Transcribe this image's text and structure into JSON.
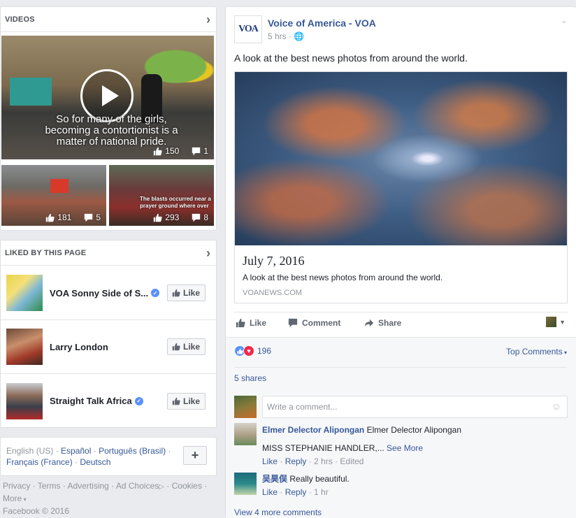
{
  "videos": {
    "title": "VIDEOS",
    "main": {
      "caption": "So for many of the girls, becoming a contortionist is a matter of national pride.",
      "likes": "150",
      "comments": "1"
    },
    "small": [
      {
        "likes": "181",
        "comments": "5"
      },
      {
        "caption": "The blasts occurred near a prayer ground where over",
        "likes": "293",
        "comments": "8"
      }
    ]
  },
  "liked": {
    "title": "LIKED BY THIS PAGE",
    "like_label": "Like",
    "items": [
      {
        "name": "VOA Sonny Side of S...",
        "verified": true
      },
      {
        "name": "Larry London",
        "verified": false
      },
      {
        "name": "Straight Talk Africa",
        "verified": true
      }
    ]
  },
  "languages": {
    "line1": [
      "English (US)",
      "Español",
      "Português (Brasil)"
    ],
    "line2": [
      "Français (France)",
      "Deutsch"
    ],
    "plus": "+"
  },
  "footer": {
    "links": [
      "Privacy",
      "Terms",
      "Advertising",
      "Ad Choices",
      "Cookies"
    ],
    "more": "More",
    "copyright": "Facebook © 2016"
  },
  "post": {
    "page_name": "Voice of America - VOA",
    "time": "5 hrs",
    "logo_text": "VOA",
    "text": "A look at the best news photos from around the world.",
    "link_title": "July 7, 2016",
    "link_desc": "A look at the best news photos from around the world.",
    "link_domain": "VOANEWS.COM",
    "actions": {
      "like": "Like",
      "comment": "Comment",
      "share": "Share"
    },
    "reactions_count": "196",
    "top_comments": "Top Comments",
    "shares": "5 shares",
    "comment_placeholder": "Write a comment...",
    "comments": [
      {
        "name": "Elmer Delector Alipongan",
        "text": "Elmer Delector Alipongan",
        "text2": "MISS STEPHANIE HANDLER,...",
        "see_more": "See More",
        "like": "Like",
        "reply": "Reply",
        "time": "2 hrs",
        "edited": "Edited"
      },
      {
        "name": "吴昊俣",
        "text": "Really beautiful.",
        "like": "Like",
        "reply": "Reply",
        "time": "1 hr"
      }
    ],
    "view_more": "View 4 more comments"
  },
  "colors": {
    "link": "#365899",
    "bg": "#e9ebee",
    "like_blue": "#5890ff",
    "love_red": "#f0284a"
  }
}
